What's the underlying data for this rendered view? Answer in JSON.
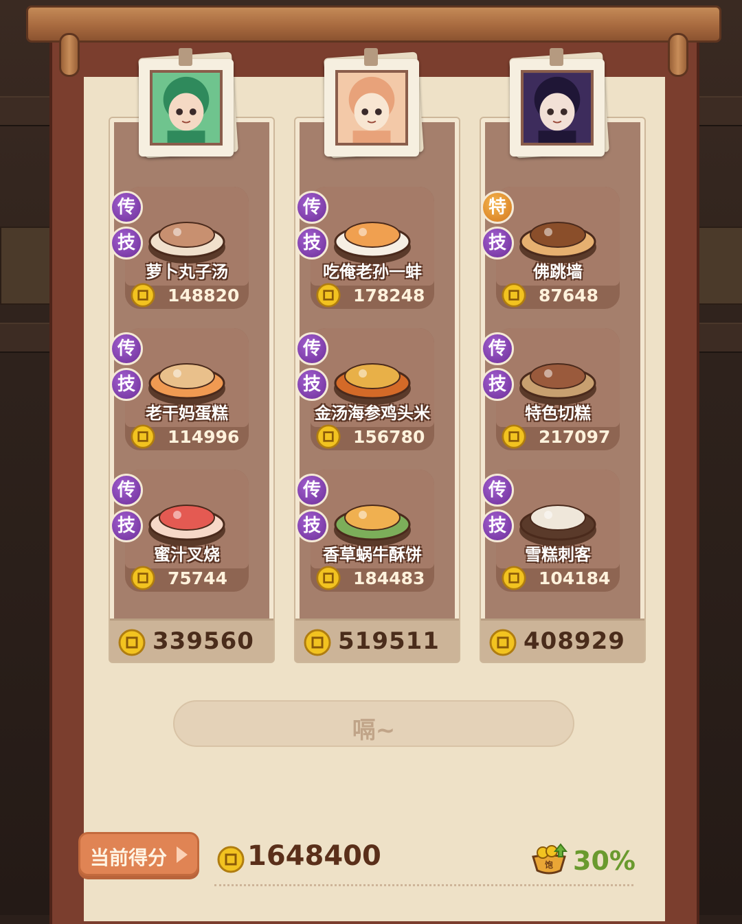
{
  "columns": [
    {
      "portrait": "green-haired-character-portrait",
      "total": "339560",
      "dishes": [
        {
          "name": "萝卜丸子汤",
          "price": "148820",
          "badge_top": "传",
          "badge_bottom": "技",
          "top_color": "purple"
        },
        {
          "name": "老干妈蛋糕",
          "price": "114996",
          "badge_top": "传",
          "badge_bottom": "技",
          "top_color": "purple"
        },
        {
          "name": "蜜汁叉烧",
          "price": "75744",
          "badge_top": "传",
          "badge_bottom": "技",
          "top_color": "purple"
        }
      ]
    },
    {
      "portrait": "pink-haired-character-portrait",
      "total": "519511",
      "dishes": [
        {
          "name": "吃俺老孙一蚌",
          "price": "178248",
          "badge_top": "传",
          "badge_bottom": "技",
          "top_color": "purple"
        },
        {
          "name": "金汤海参鸡头米",
          "price": "156780",
          "badge_top": "传",
          "badge_bottom": "技",
          "top_color": "purple"
        },
        {
          "name": "香草蜗牛酥饼",
          "price": "184483",
          "badge_top": "传",
          "badge_bottom": "技",
          "top_color": "purple"
        }
      ]
    },
    {
      "portrait": "dark-haired-character-portrait",
      "total": "408929",
      "dishes": [
        {
          "name": "佛跳墙",
          "price": "87648",
          "badge_top": "特",
          "badge_bottom": "技",
          "top_color": "orange"
        },
        {
          "name": "特色切糕",
          "price": "217097",
          "badge_top": "传",
          "badge_bottom": "技",
          "top_color": "purple"
        },
        {
          "name": "雪糕刺客",
          "price": "104184",
          "badge_top": "传",
          "badge_bottom": "技",
          "top_color": "purple"
        }
      ]
    }
  ],
  "message": "嗝~",
  "score_tab_label": "当前得分",
  "current_score": "1648400",
  "bonus_percent": "30%",
  "colors": {
    "purple_badge": "#7a3aa6",
    "orange_badge": "#e08a2a",
    "bonus": "#6a9a2e",
    "score_tab": "#e08454"
  }
}
